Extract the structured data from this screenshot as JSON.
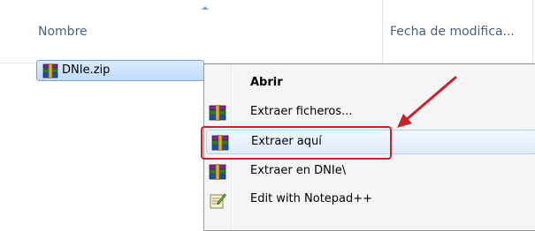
{
  "header": {
    "name_column": "Nombre",
    "date_column": "Fecha de modifica..."
  },
  "file": {
    "name": "DNIe.zip",
    "icon": "winrar-archive-icon"
  },
  "context_menu": {
    "items": [
      {
        "label": "Abrir",
        "icon": "none",
        "bold": true
      },
      {
        "label": "Extraer ficheros...",
        "icon": "winrar-icon"
      },
      {
        "label": "Extraer aquí",
        "icon": "winrar-icon",
        "highlighted": true
      },
      {
        "label": "Extraer en DNIe\\",
        "icon": "winrar-icon"
      },
      {
        "label": "Edit with Notepad++",
        "icon": "notepad-plus-plus-icon"
      }
    ]
  },
  "annotation": {
    "box_color": "#c8232c",
    "arrow_color": "#c8232c"
  }
}
